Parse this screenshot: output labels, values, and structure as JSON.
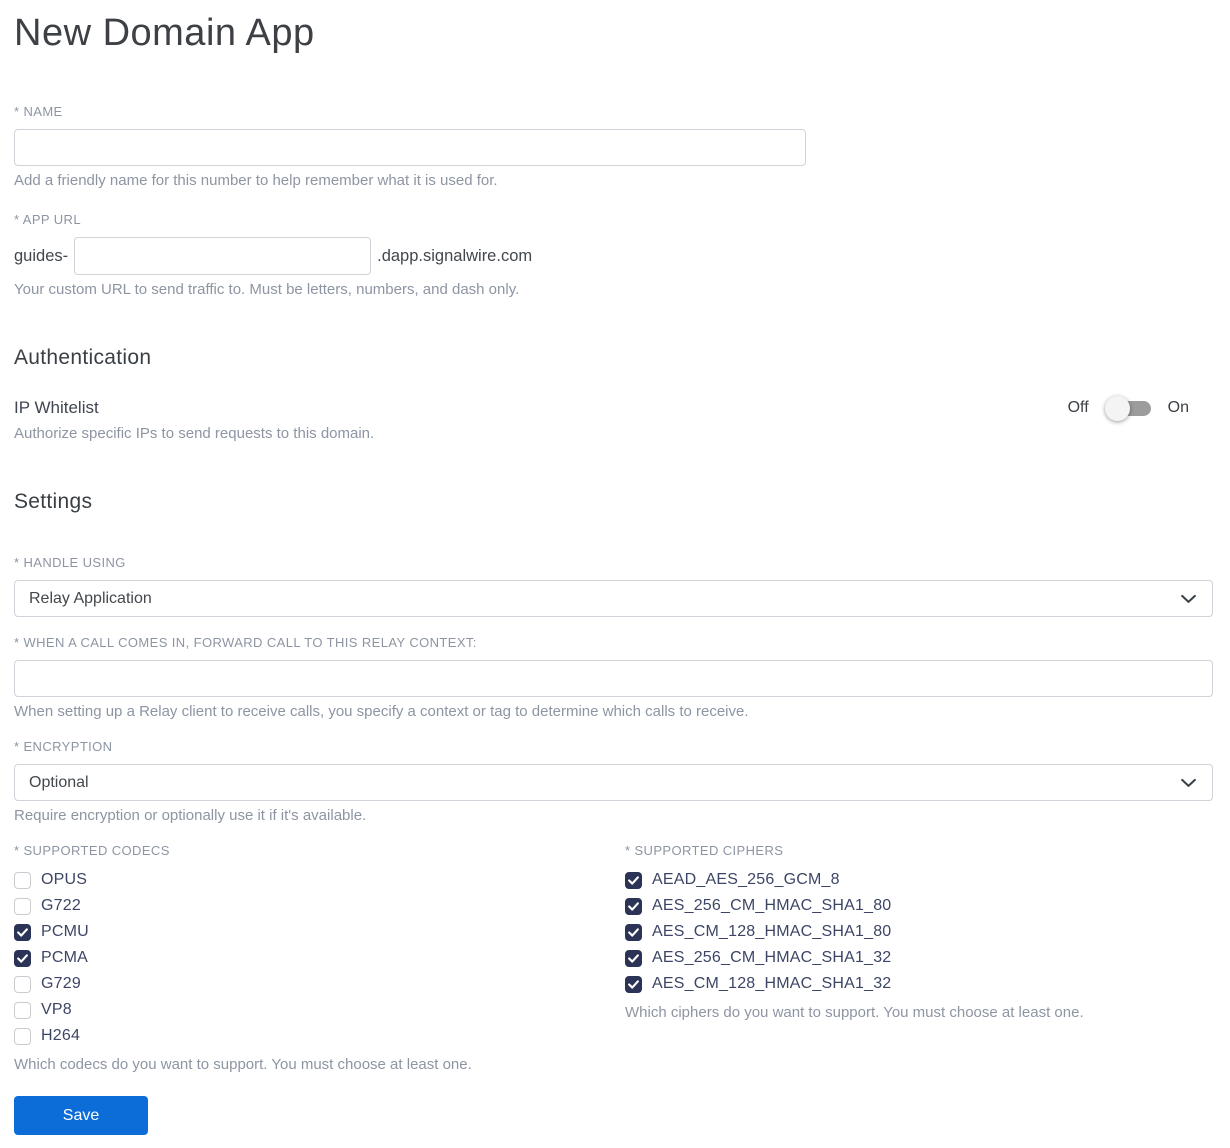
{
  "page": {
    "title": "New Domain App"
  },
  "name_field": {
    "label": "* NAME",
    "value": "",
    "help": "Add a friendly name for this number to help remember what it is used for."
  },
  "app_url_field": {
    "label": "* APP URL",
    "prefix": "guides-",
    "value": "",
    "suffix": ".dapp.signalwire.com",
    "help": "Your custom URL to send traffic to. Must be letters, numbers, and dash only."
  },
  "authentication": {
    "heading": "Authentication",
    "ip_whitelist": {
      "label": "IP Whitelist",
      "help": "Authorize specific IPs to send requests to this domain.",
      "off_label": "Off",
      "on_label": "On",
      "state": "off"
    }
  },
  "settings": {
    "heading": "Settings",
    "handle_using": {
      "label": "* HANDLE USING",
      "value": "Relay Application"
    },
    "relay_context": {
      "label": "* WHEN A CALL COMES IN, FORWARD CALL TO THIS RELAY CONTEXT:",
      "value": "",
      "help": "When setting up a Relay client to receive calls, you specify a context or tag to determine which calls to receive."
    },
    "encryption": {
      "label": "* ENCRYPTION",
      "value": "Optional",
      "help": "Require encryption or optionally use it if it's available."
    },
    "codecs": {
      "label": "* SUPPORTED CODECS",
      "help": "Which codecs do you want to support. You must choose at least one.",
      "options": [
        {
          "label": "OPUS",
          "checked": false
        },
        {
          "label": "G722",
          "checked": false
        },
        {
          "label": "PCMU",
          "checked": true
        },
        {
          "label": "PCMA",
          "checked": true
        },
        {
          "label": "G729",
          "checked": false
        },
        {
          "label": "VP8",
          "checked": false
        },
        {
          "label": "H264",
          "checked": false
        }
      ]
    },
    "ciphers": {
      "label": "* SUPPORTED CIPHERS",
      "help": "Which ciphers do you want to support. You must choose at least one.",
      "options": [
        {
          "label": "AEAD_AES_256_GCM_8",
          "checked": true
        },
        {
          "label": "AES_256_CM_HMAC_SHA1_80",
          "checked": true
        },
        {
          "label": "AES_CM_128_HMAC_SHA1_80",
          "checked": true
        },
        {
          "label": "AES_256_CM_HMAC_SHA1_32",
          "checked": true
        },
        {
          "label": "AES_CM_128_HMAC_SHA1_32",
          "checked": true
        }
      ]
    }
  },
  "save_button": {
    "label": "Save"
  },
  "colors": {
    "accent_blue": "#0d6dd8",
    "checkbox_checked": "#2b3356",
    "toggle_track": "#9c9c9c",
    "toggle_knob": "#f4f4f4"
  }
}
